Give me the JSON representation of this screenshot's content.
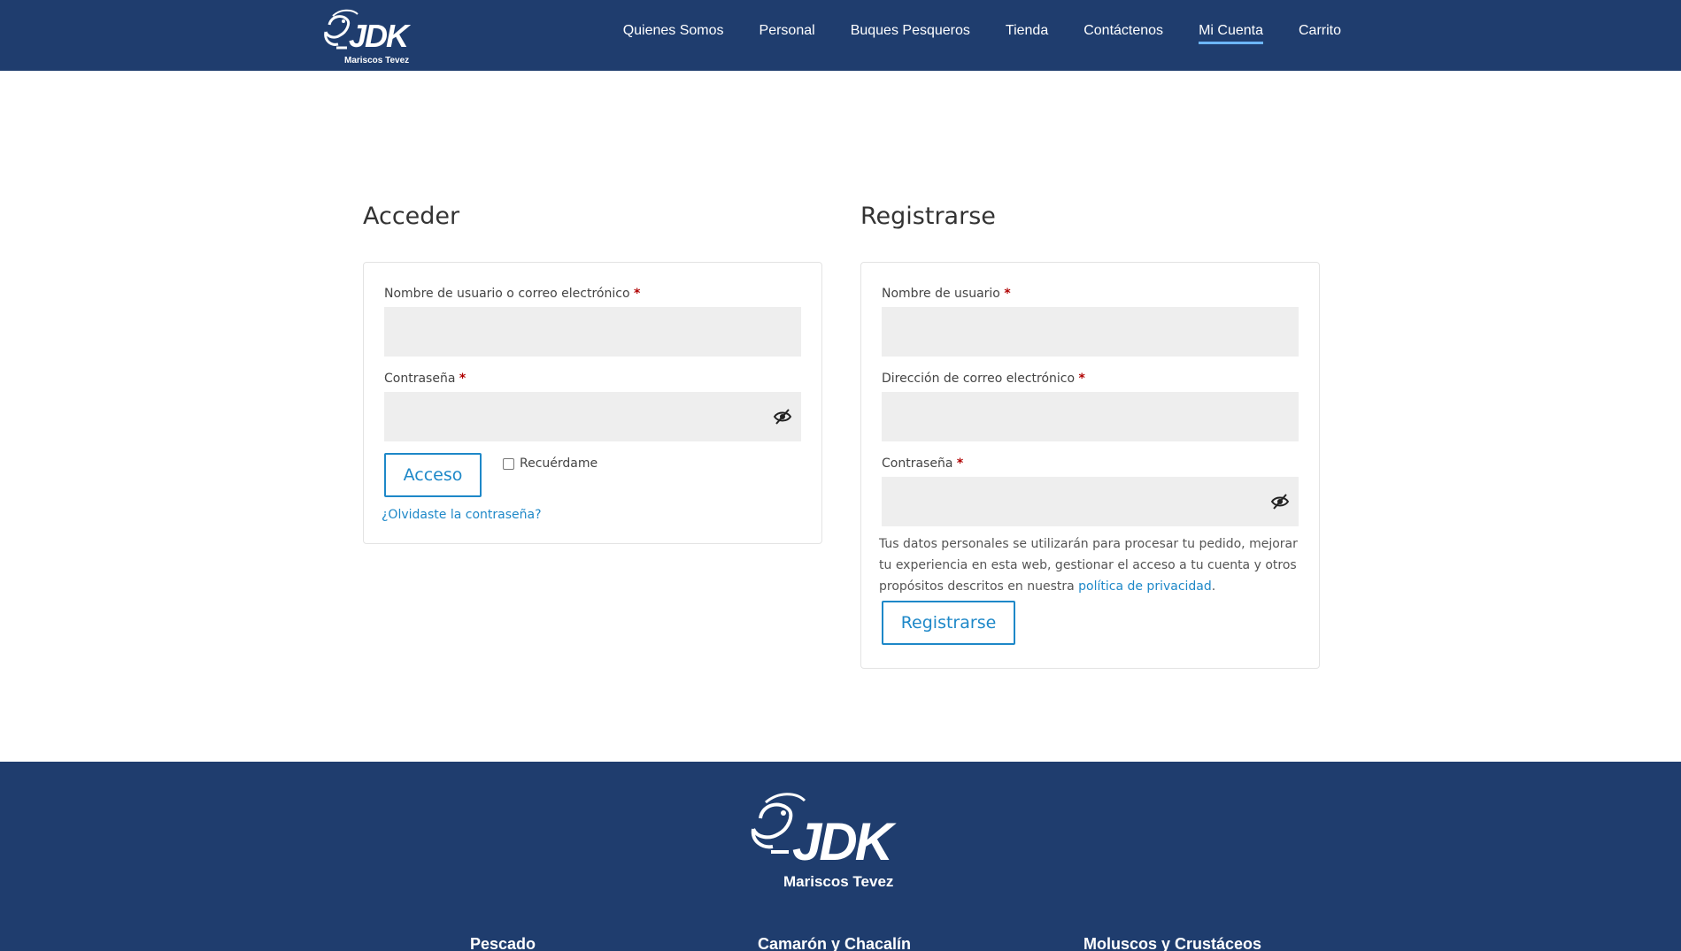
{
  "brand": {
    "logo_text": "JDK",
    "subtitle": "Mariscos Tevez"
  },
  "nav": {
    "items": [
      {
        "label": "Quienes Somos"
      },
      {
        "label": "Personal"
      },
      {
        "label": "Buques Pesqueros"
      },
      {
        "label": "Tienda"
      },
      {
        "label": "Contáctenos"
      },
      {
        "label": "Mi Cuenta"
      },
      {
        "label": "Carrito"
      }
    ],
    "active": "Mi Cuenta"
  },
  "login": {
    "title": "Acceder",
    "username_label": "Nombre de usuario o correo electrónico",
    "password_label": "Contraseña",
    "required_mark": "*",
    "submit_label": "Acceso",
    "remember_label": "Recuérdame",
    "lost_password_label": "¿Olvidaste la contraseña?"
  },
  "register": {
    "title": "Registrarse",
    "username_label": "Nombre de usuario",
    "email_label": "Dirección de correo electrónico",
    "password_label": "Contraseña",
    "required_mark": "*",
    "privacy_text": "Tus datos personales se utilizarán para procesar tu pedido, mejorar tu experiencia en esta web, gestionar el acceso a tu cuenta y otros propósitos descritos en nuestra",
    "privacy_link": "política de privacidad",
    "privacy_end": ".",
    "submit_label": "Registrarse"
  },
  "footer": {
    "logo_text": "JDK",
    "subtitle": "Mariscos Tevez",
    "categories": [
      "Pescado",
      "Camarón y Chacalín",
      "Moluscos y Crustáceos"
    ]
  },
  "colors": {
    "header_bg": "#1f3d6e",
    "accent": "#1e88c8",
    "active_underline": "#6cb6ff",
    "required": "#b00000"
  }
}
